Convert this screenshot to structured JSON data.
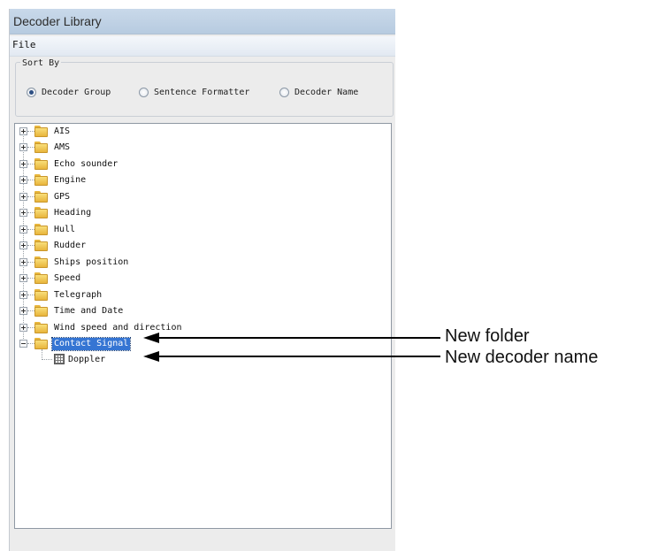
{
  "window": {
    "title": "Decoder Library"
  },
  "menu": {
    "file": "File"
  },
  "sort": {
    "label": "Sort By",
    "options": [
      {
        "label": "Decoder Group",
        "selected": true
      },
      {
        "label": "Sentence Formatter",
        "selected": false
      },
      {
        "label": "Decoder Name",
        "selected": false
      }
    ]
  },
  "tree": {
    "folders": [
      {
        "label": "AIS"
      },
      {
        "label": "AMS"
      },
      {
        "label": "Echo sounder"
      },
      {
        "label": "Engine"
      },
      {
        "label": "GPS"
      },
      {
        "label": "Heading"
      },
      {
        "label": "Hull"
      },
      {
        "label": "Rudder"
      },
      {
        "label": "Ships position"
      },
      {
        "label": "Speed"
      },
      {
        "label": "Telegraph"
      },
      {
        "label": "Time and Date"
      },
      {
        "label": "Wind speed and direction"
      },
      {
        "label": "Contact Signal",
        "selected": true,
        "expanded": true
      }
    ],
    "child": {
      "label": "Doppler"
    }
  },
  "annotations": {
    "new_folder": "New folder",
    "new_decoder": "New decoder name"
  },
  "colors": {
    "selection": "#3575d3",
    "folder": "#e8b53c",
    "titlebar": "#c9d9ea"
  }
}
